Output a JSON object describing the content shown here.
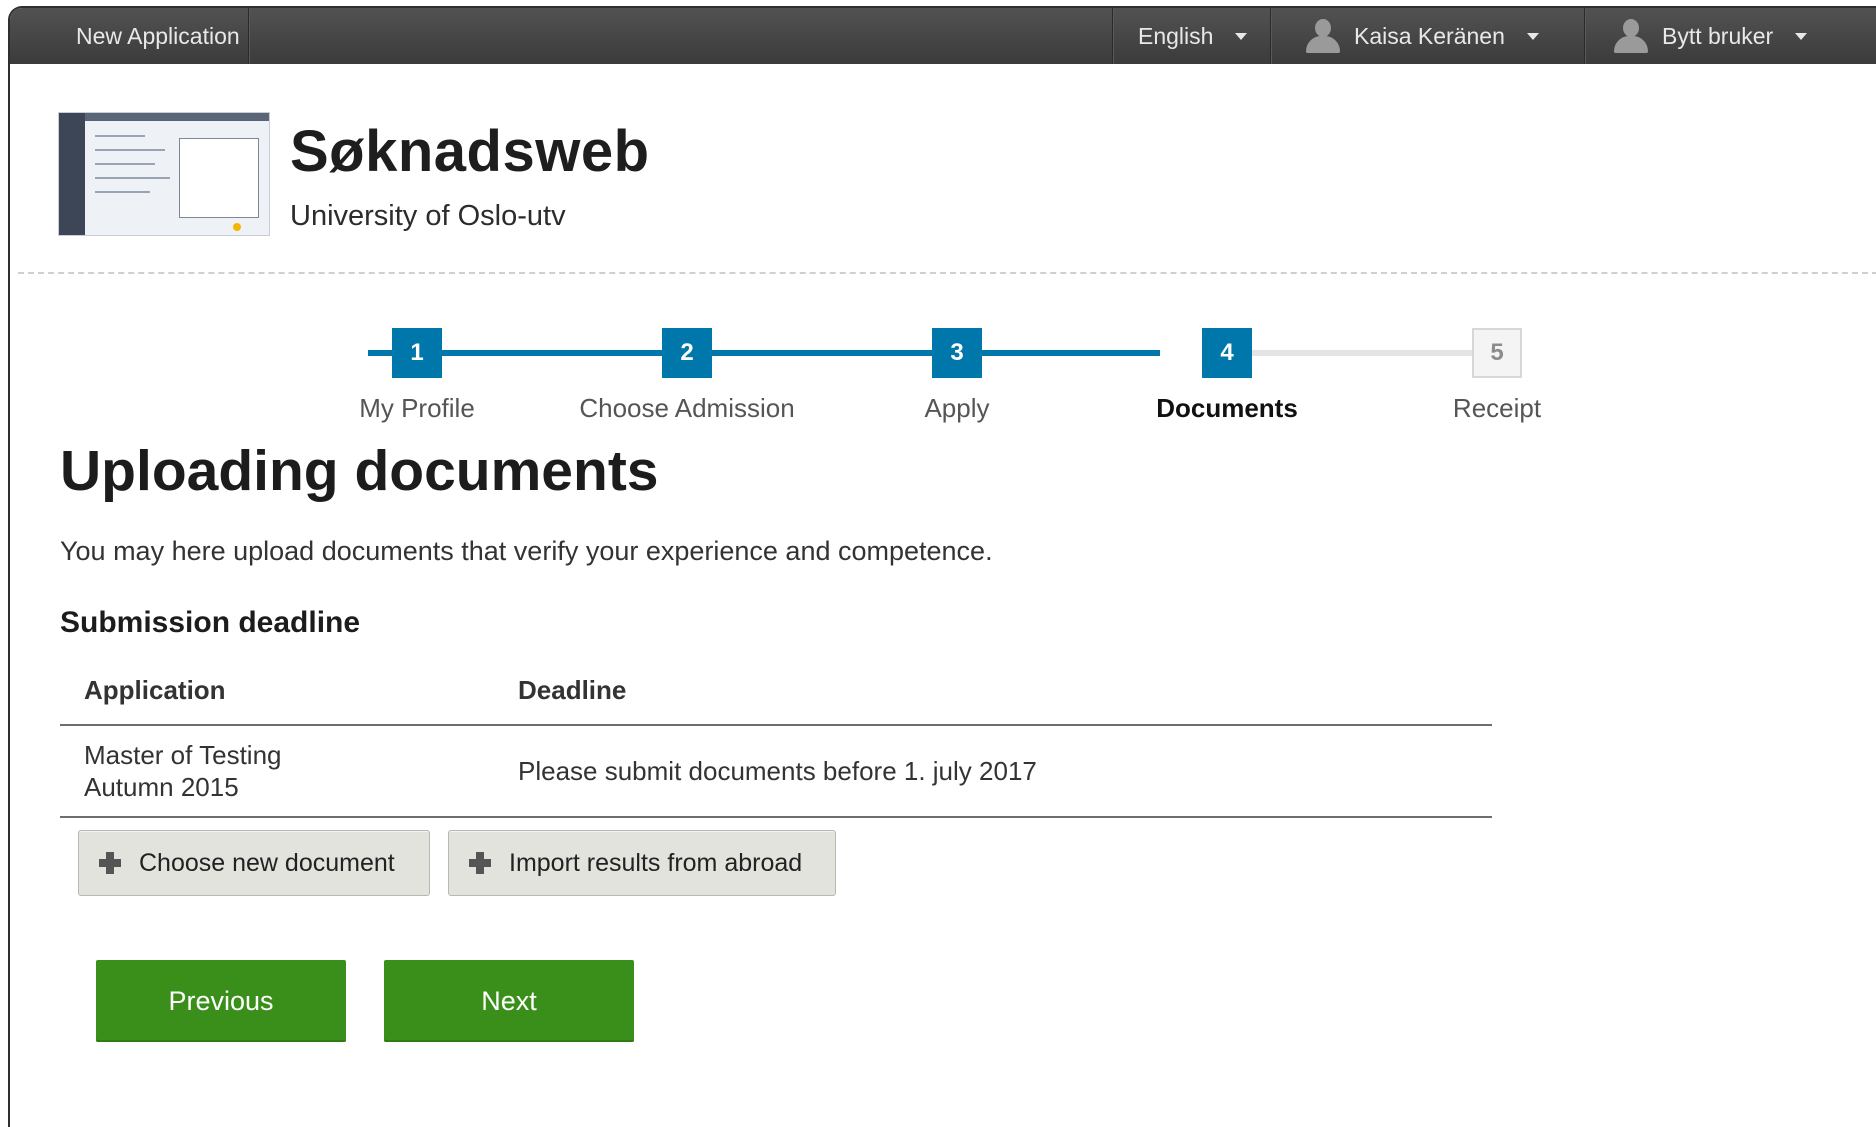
{
  "topbar": {
    "app_label": "New Application",
    "language": "English",
    "user": "Kaisa Keränen",
    "switch_user": "Bytt bruker"
  },
  "header": {
    "title": "Søknadsweb",
    "subtitle": "University of Oslo-utv"
  },
  "stepper": {
    "steps": [
      {
        "number": "1",
        "label": "My Profile",
        "state": "done"
      },
      {
        "number": "2",
        "label": "Choose Admission",
        "state": "done"
      },
      {
        "number": "3",
        "label": "Apply",
        "state": "done"
      },
      {
        "number": "4",
        "label": "Documents",
        "state": "active"
      },
      {
        "number": "5",
        "label": "Receipt",
        "state": "todo"
      }
    ],
    "active_color": "#0077aa"
  },
  "main": {
    "title": "Uploading documents",
    "intro": "You may here upload documents that verify your experience and competence.",
    "section_title": "Submission deadline",
    "table": {
      "headers": [
        "Application",
        "Deadline"
      ],
      "rows": [
        {
          "application_line1": "Master of Testing",
          "application_line2": "Autumn 2015",
          "deadline": "Please submit documents before 1. july 2017"
        }
      ]
    },
    "buttons": {
      "choose_document": "Choose new document",
      "import_results": "Import results from abroad",
      "previous": "Previous",
      "next": "Next"
    }
  },
  "colors": {
    "topbar": "#424242",
    "primary_green": "#3a8f1a",
    "step_blue": "#0077aa"
  }
}
